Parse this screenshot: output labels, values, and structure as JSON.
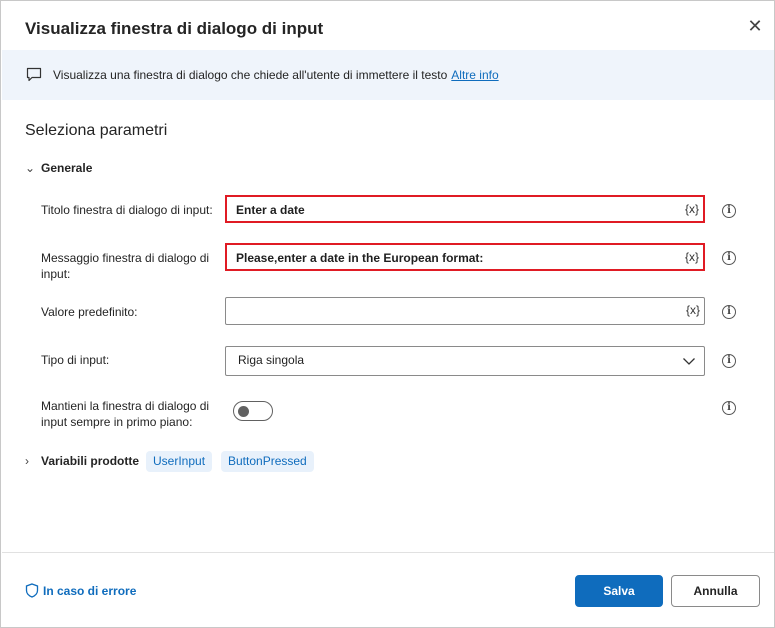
{
  "dialog": {
    "title": "Visualizza finestra di dialogo di input",
    "close_icon": "close-icon"
  },
  "info": {
    "text": "Visualizza una finestra di dialogo che chiede all'utente di immettere il testo",
    "link": "Altre info"
  },
  "section_title": "Seleziona parametri",
  "group_general": "Generale",
  "fields": {
    "title": {
      "label": "Titolo finestra di dialogo di input:",
      "value": "Enter a date",
      "var": "{x}"
    },
    "message": {
      "label_line1": "Messaggio finestra di dialogo di",
      "label_line2": "input:",
      "value": "Please,enter a date in the European format:",
      "var": "{x}"
    },
    "default": {
      "label": "Valore predefinito:",
      "value": "",
      "var": "{x}"
    },
    "input_type": {
      "label": "Tipo di input:",
      "value": "Riga singola"
    },
    "always_on_top": {
      "label_line1": "Mantieni la finestra di dialogo di",
      "label_line2": "input sempre in primo piano:",
      "on": false
    }
  },
  "variables": {
    "label": "Variabili prodotte",
    "items": [
      "UserInput",
      "ButtonPressed"
    ]
  },
  "footer": {
    "error_link": "In caso di errore",
    "save": "Salva",
    "cancel": "Annulla"
  },
  "colors": {
    "accent": "#0f6cbd",
    "highlight": "#e01b24",
    "info_bg": "#eff4fb"
  }
}
